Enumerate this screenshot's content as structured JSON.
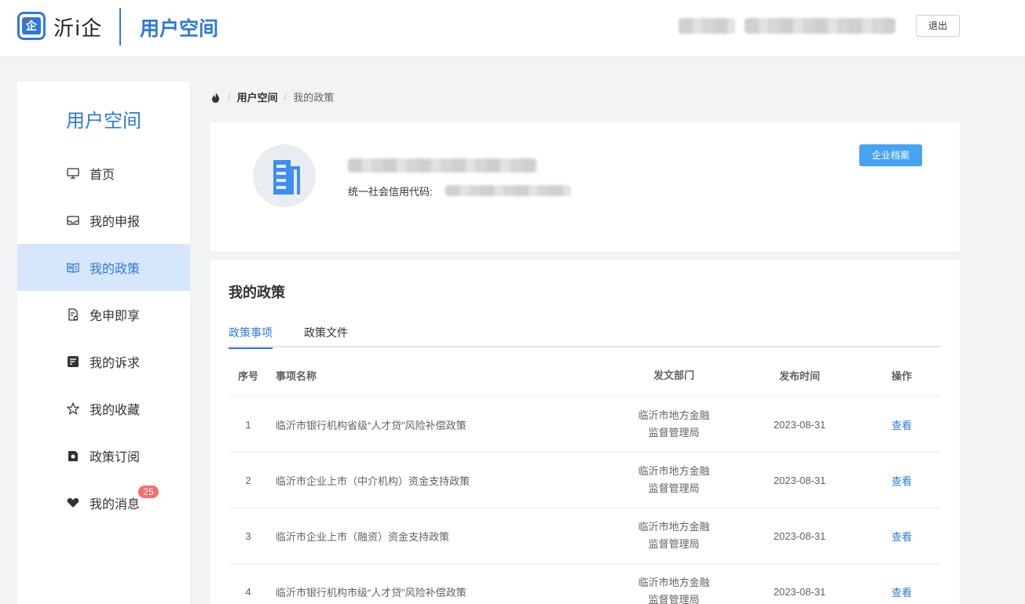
{
  "header": {
    "brand": "沂i企",
    "logo_glyph": "企",
    "title": "用户空间",
    "logout_label": "退出"
  },
  "sidebar": {
    "title": "用户空间",
    "items": [
      {
        "label": "首页",
        "icon": "monitor-icon"
      },
      {
        "label": "我的申报",
        "icon": "tray-icon"
      },
      {
        "label": "我的政策",
        "icon": "policy-book-icon",
        "active": true
      },
      {
        "label": "免申即享",
        "icon": "document-check-icon"
      },
      {
        "label": "我的诉求",
        "icon": "edit-note-icon"
      },
      {
        "label": "我的收藏",
        "icon": "star-icon"
      },
      {
        "label": "政策订阅",
        "icon": "subscribe-icon"
      },
      {
        "label": "我的消息",
        "icon": "heart-icon",
        "badge": "25"
      }
    ]
  },
  "breadcrumb": {
    "home_icon": "flame-icon",
    "level1": "用户空间",
    "level2": "我的政策"
  },
  "profile": {
    "credit_label": "统一社会信用代码:",
    "archive_button": "企业档案"
  },
  "policy": {
    "title": "我的政策",
    "tabs": [
      "政策事项",
      "政策文件"
    ],
    "active_tab": 0,
    "columns": {
      "index": "序号",
      "name": "事项名称",
      "dept": "发文部门",
      "date": "发布时间",
      "op": "操作"
    },
    "rows": [
      {
        "index": "1",
        "name": "临沂市银行机构省级“人才贷”风险补偿政策",
        "dept_line1": "临沂市地方金融",
        "dept_line2": "监督管理局",
        "date": "2023-08-31",
        "op": "查看"
      },
      {
        "index": "2",
        "name": "临沂市企业上市（中介机构）资金支持政策",
        "dept_line1": "临沂市地方金融",
        "dept_line2": "监督管理局",
        "date": "2023-08-31",
        "op": "查看"
      },
      {
        "index": "3",
        "name": "临沂市企业上市（融资）资金支持政策",
        "dept_line1": "临沂市地方金融",
        "dept_line2": "监督管理局",
        "date": "2023-08-31",
        "op": "查看"
      },
      {
        "index": "4",
        "name": "临沂市银行机构市级“人才贷”风险补偿政策",
        "dept_line1": "临沂市地方金融",
        "dept_line2": "监督管理局",
        "date": "2023-08-31",
        "op": "查看"
      }
    ]
  },
  "colors": {
    "accent": "#2f7ad9",
    "button": "#46a3f2",
    "active_bg": "#d6e7fb",
    "badge": "#f56c6c"
  }
}
